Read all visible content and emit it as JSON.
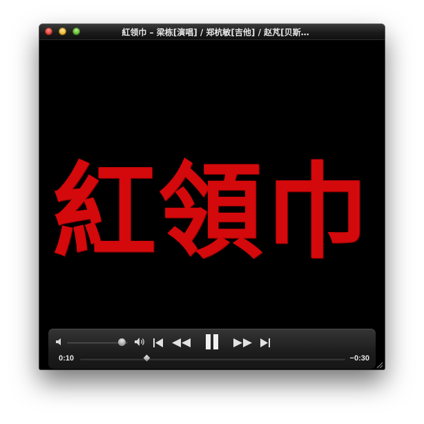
{
  "window": {
    "title": "紅领巾 – 梁栋[演唱] / 郑杭敏[吉他] / 赵芃[贝斯…"
  },
  "video": {
    "frame_text": "紅領巾"
  },
  "controls": {
    "volume_level": 0.9,
    "current_time": "0:10",
    "remaining_time": "−0:30",
    "playback_progress": 0.25
  },
  "icons": {
    "volume_low": "speaker-low-icon",
    "volume_high": "speaker-high-icon",
    "skip_back": "skip-to-start-icon",
    "rewind": "rewind-icon",
    "play_pause": "pause-icon",
    "fast_forward": "fast-forward-icon",
    "skip_forward": "skip-to-end-icon",
    "resize": "resize-grip-icon"
  },
  "colors": {
    "title_text": "#e6e6e6",
    "video_text": "#d4090c",
    "close_button": "#e0443a",
    "minimize_button": "#e8b531",
    "zoom_button": "#63b837"
  }
}
